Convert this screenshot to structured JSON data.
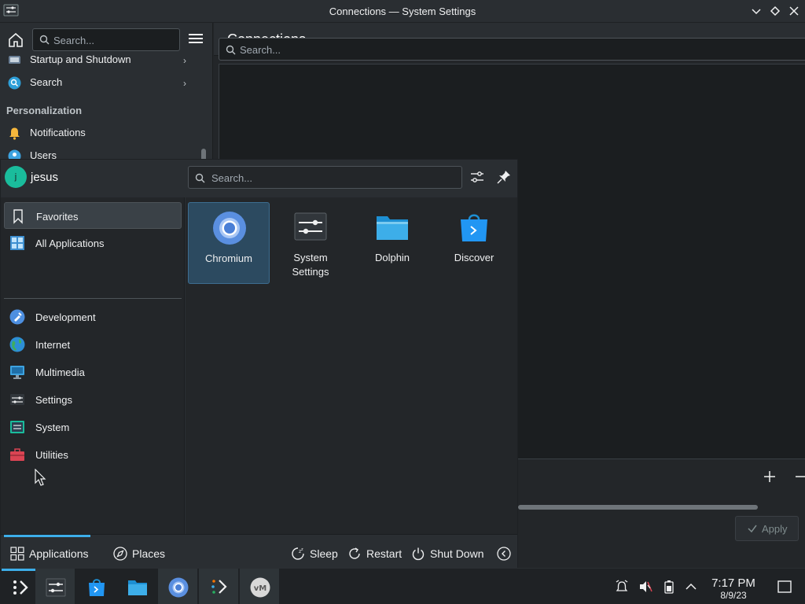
{
  "window": {
    "title": "Connections — System Settings"
  },
  "settings_sidebar": {
    "search_placeholder": "Search...",
    "items": [
      {
        "label": "Startup and Shutdown",
        "icon": "startup-icon"
      },
      {
        "label": "Search",
        "icon": "search-category-icon"
      }
    ],
    "section": "Personalization",
    "section_items": [
      {
        "label": "Notifications",
        "icon": "bell-icon"
      },
      {
        "label": "Users",
        "icon": "users-icon"
      }
    ]
  },
  "settings_page": {
    "heading": "Connections",
    "search_placeholder": "Search...",
    "apply_label": "Apply"
  },
  "launcher": {
    "username": "jesus",
    "avatar_letter": "j",
    "search_placeholder": "Search...",
    "categories": [
      {
        "label": "Favorites",
        "icon": "bookmark-icon",
        "selected": true
      },
      {
        "label": "All Applications",
        "icon": "grid-icon"
      },
      {
        "label": "Development",
        "icon": "development-icon"
      },
      {
        "label": "Internet",
        "icon": "globe-icon"
      },
      {
        "label": "Multimedia",
        "icon": "multimedia-icon"
      },
      {
        "label": "Settings",
        "icon": "settings-category-icon"
      },
      {
        "label": "System",
        "icon": "system-icon"
      },
      {
        "label": "Utilities",
        "icon": "utilities-icon"
      }
    ],
    "favorites": [
      {
        "label": "Chromium",
        "icon": "chromium-icon",
        "selected": true
      },
      {
        "label": "System\nSettings",
        "icon": "system-settings-icon"
      },
      {
        "label": "Dolphin",
        "icon": "dolphin-folder-icon"
      },
      {
        "label": "Discover",
        "icon": "discover-icon"
      }
    ],
    "footer": {
      "applications": "Applications",
      "places": "Places",
      "sleep": "Sleep",
      "restart": "Restart",
      "shutdown": "Shut Down"
    }
  },
  "taskbar": {
    "apps": [
      "launcher-icon",
      "system-settings-icon",
      "discover-icon",
      "dolphin-folder-icon",
      "chromium-icon",
      "kdeconnect-icon",
      "vmware-icon"
    ],
    "time": "7:17 PM",
    "date": "8/9/23"
  },
  "colors": {
    "accent": "#3daee9",
    "background": "#232629",
    "panel": "#2a2e32"
  }
}
